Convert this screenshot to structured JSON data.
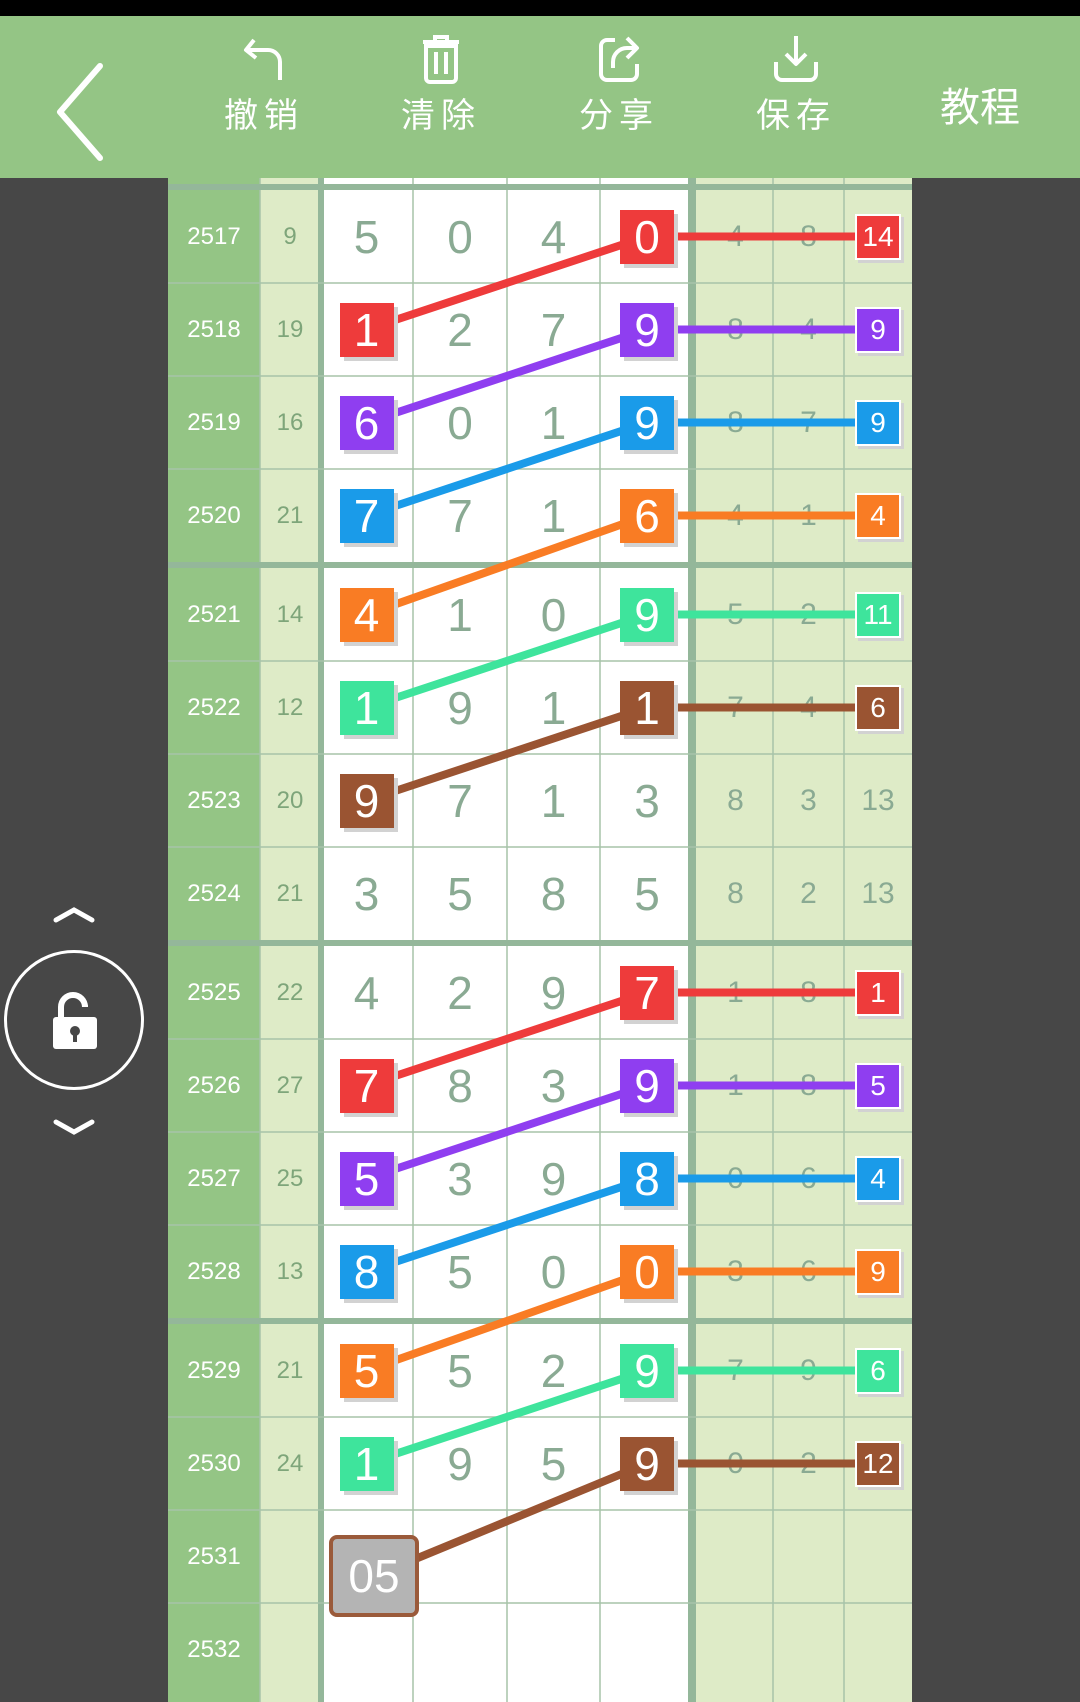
{
  "toolbar": {
    "back_icon": "chevron-left-icon",
    "undo_label": "撤销",
    "clear_label": "清除",
    "share_label": "分享",
    "save_label": "保存",
    "tutorial_label": "教程"
  },
  "colors": {
    "toolbar_bg": "#94c585",
    "period_col_bg": "#94c585",
    "sum_col_bg": "#deebc7",
    "stats_bg": "#deebc7",
    "grid_bg": "#ffffff",
    "page_bg": "#474747",
    "red": "#ee3b3b",
    "purple": "#8f3ef0",
    "blue": "#1a9be9",
    "orange": "#f97c24",
    "green": "#3ee49c",
    "brown": "#9a5432"
  },
  "side_control": {
    "up_icon": "chevron-up-icon",
    "lock_icon": "unlock-icon",
    "down_icon": "chevron-down-icon"
  },
  "rows": [
    {
      "period": "2517",
      "sum": "9",
      "digits": [
        "5",
        "0",
        "4",
        "0"
      ],
      "stats": [
        "4",
        "8",
        "14"
      ],
      "hl": 3,
      "color": "red"
    },
    {
      "period": "2518",
      "sum": "19",
      "digits": [
        "1",
        "2",
        "7",
        "9"
      ],
      "stats": [
        "8",
        "4",
        "9"
      ],
      "hl": 3,
      "color": "purple",
      "start": 0,
      "startColor": "red"
    },
    {
      "period": "2519",
      "sum": "16",
      "digits": [
        "6",
        "0",
        "1",
        "9"
      ],
      "stats": [
        "8",
        "7",
        "9"
      ],
      "hl": 3,
      "color": "blue",
      "start": 0,
      "startColor": "purple"
    },
    {
      "period": "2520",
      "sum": "21",
      "digits": [
        "7",
        "7",
        "1",
        "6"
      ],
      "stats": [
        "4",
        "1",
        "4"
      ],
      "hl": 3,
      "color": "orange",
      "start": 0,
      "startColor": "blue"
    },
    {
      "period": "2521",
      "sum": "14",
      "digits": [
        "4",
        "1",
        "0",
        "9"
      ],
      "stats": [
        "5",
        "2",
        "11"
      ],
      "hl": 3,
      "color": "green",
      "start": 0,
      "startColor": "orange"
    },
    {
      "period": "2522",
      "sum": "12",
      "digits": [
        "1",
        "9",
        "1",
        "1"
      ],
      "stats": [
        "7",
        "4",
        "6"
      ],
      "hl": 3,
      "color": "brown",
      "start": 0,
      "startColor": "green"
    },
    {
      "period": "2523",
      "sum": "20",
      "digits": [
        "9",
        "7",
        "1",
        "3"
      ],
      "stats": [
        "8",
        "3",
        "13"
      ],
      "start": 0,
      "startColor": "brown"
    },
    {
      "period": "2524",
      "sum": "21",
      "digits": [
        "3",
        "5",
        "8",
        "5"
      ],
      "stats": [
        "8",
        "2",
        "13"
      ]
    },
    {
      "period": "2525",
      "sum": "22",
      "digits": [
        "4",
        "2",
        "9",
        "7"
      ],
      "stats": [
        "1",
        "8",
        "1"
      ],
      "hl": 3,
      "color": "red"
    },
    {
      "period": "2526",
      "sum": "27",
      "digits": [
        "7",
        "8",
        "3",
        "9"
      ],
      "stats": [
        "1",
        "8",
        "5"
      ],
      "hl": 3,
      "color": "purple",
      "start": 0,
      "startColor": "red"
    },
    {
      "period": "2527",
      "sum": "25",
      "digits": [
        "5",
        "3",
        "9",
        "8"
      ],
      "stats": [
        "0",
        "6",
        "4"
      ],
      "hl": 3,
      "color": "blue",
      "start": 0,
      "startColor": "purple"
    },
    {
      "period": "2528",
      "sum": "13",
      "digits": [
        "8",
        "5",
        "0",
        "0"
      ],
      "stats": [
        "3",
        "6",
        "9"
      ],
      "hl": 3,
      "color": "orange",
      "start": 0,
      "startColor": "blue"
    },
    {
      "period": "2529",
      "sum": "21",
      "digits": [
        "5",
        "5",
        "2",
        "9"
      ],
      "stats": [
        "7",
        "9",
        "6"
      ],
      "hl": 3,
      "color": "green",
      "start": 0,
      "startColor": "orange"
    },
    {
      "period": "2530",
      "sum": "24",
      "digits": [
        "1",
        "9",
        "5",
        "9"
      ],
      "stats": [
        "0",
        "2",
        "12"
      ],
      "hl": 3,
      "color": "brown",
      "start": 0,
      "startColor": "green"
    },
    {
      "period": "2531",
      "sum": "",
      "digits": [
        "",
        "",
        "",
        ""
      ],
      "stats": [
        "",
        "",
        ""
      ]
    },
    {
      "period": "2532",
      "sum": "",
      "digits": [
        "",
        "",
        "",
        ""
      ],
      "stats": [
        "",
        "",
        ""
      ]
    }
  ],
  "input_value": "05"
}
